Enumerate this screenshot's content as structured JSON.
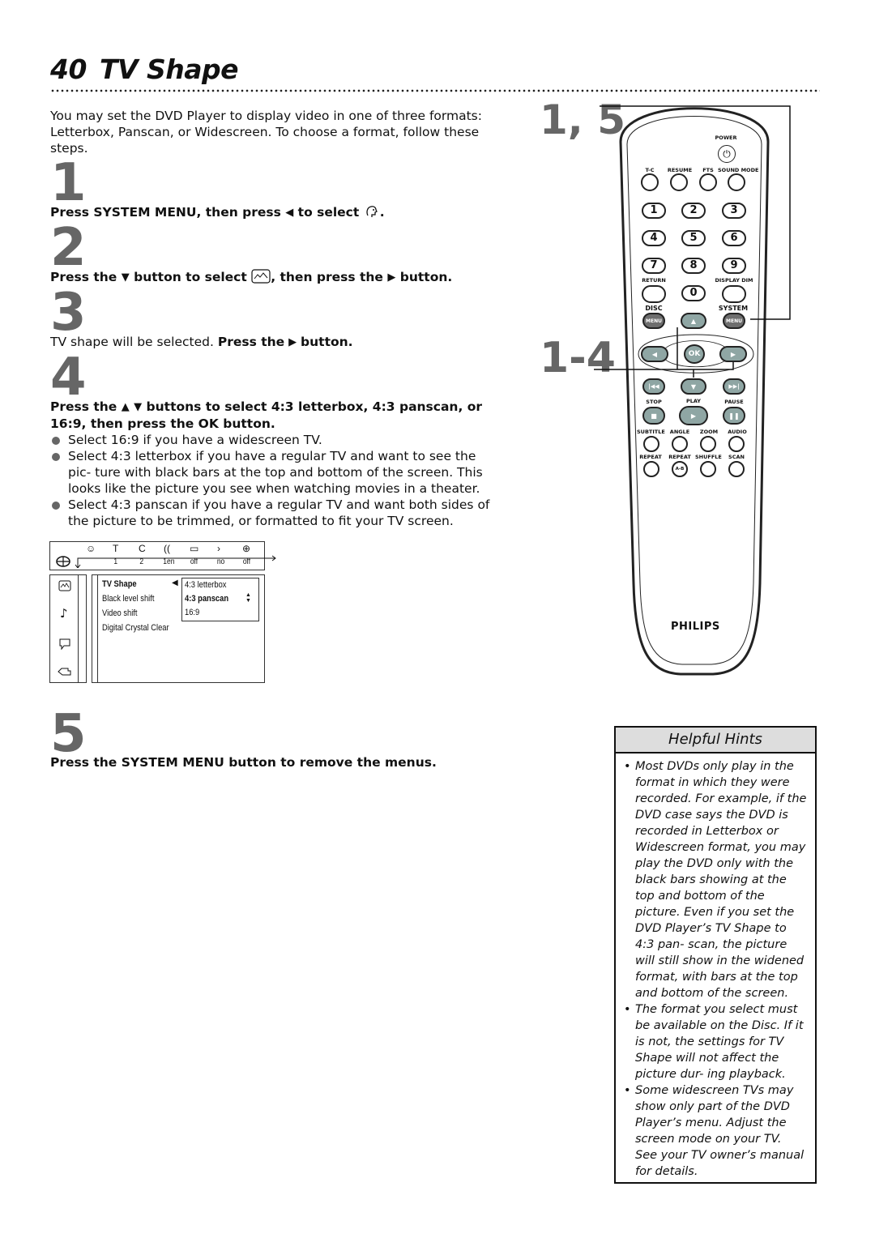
{
  "page": {
    "number": "40",
    "title": "TV Shape",
    "intro": "You may set the DVD Player to display video in one of three formats: Letterbox, Panscan, or Widescreen. To choose a format, follow these steps."
  },
  "steps": [
    {
      "num": "1",
      "parts": {
        "a": "Press SYSTEM MENU, then press",
        "b": "to select",
        "c": "."
      }
    },
    {
      "num": "2",
      "parts": {
        "a": "Press the",
        "b": "button to select",
        "c": ", then press the",
        "d": "button."
      }
    },
    {
      "num": "3",
      "parts": {
        "a": "TV shape will be selected.",
        "b": "Press the",
        "c": "button."
      }
    },
    {
      "num": "4",
      "parts": {
        "a": "Press the",
        "b": "buttons to select 4:3 letterbox, 4:3 panscan, or 16:9, then press the OK button."
      },
      "bullets": [
        "Select 16:9 if you have a widescreen TV.",
        "Select 4:3 letterbox if you have a regular TV and want to see the pic- ture with black bars at the top and bottom of the screen. This looks like the picture you see when watching movies in a theater.",
        "Select 4:3 panscan if you have a regular TV and want both sides of the picture to be trimmed, or formatted to fit your TV screen."
      ]
    },
    {
      "num": "5",
      "parts": {
        "a": "Press the SYSTEM MENU button to remove the menus."
      }
    }
  ],
  "osd": {
    "top_icons": [
      "settings-face-icon",
      "title-icon",
      "chapter-icon",
      "audio-lang-icon",
      "subtitle-icon",
      "angle-icon",
      "zoom-icon"
    ],
    "top_values": [
      "1",
      "2",
      "1en",
      "off",
      "no",
      "off"
    ],
    "menu_items": [
      "TV Shape",
      "Black level shift",
      "Video shift",
      "Digital Crystal Clear"
    ],
    "options": [
      "4:3 letterbox",
      "4:3 panscan",
      "16:9"
    ],
    "selected_option": "4:3 panscan"
  },
  "remote": {
    "callout_top": "1, 5",
    "callout_mid": "1-4",
    "labels": {
      "power": "POWER",
      "tc": "T-C",
      "resume": "RESUME",
      "fts": "FTS",
      "sound_mode": "SOUND MODE",
      "return": "RETURN",
      "display_dim": "DISPLAY DIM",
      "disc": "DISC",
      "system": "SYSTEM",
      "menu": "MENU",
      "ok": "OK",
      "stop": "STOP",
      "play": "PLAY",
      "pause": "PAUSE",
      "subtitle": "SUBTITLE",
      "angle": "ANGLE",
      "zoom": "ZOOM",
      "audio": "AUDIO",
      "repeat": "REPEAT",
      "repeat_ab": "REPEAT",
      "ab": "A-B",
      "shuffle": "SHUFFLE",
      "scan": "SCAN",
      "brand": "PHILIPS"
    },
    "digits": [
      "1",
      "2",
      "3",
      "4",
      "5",
      "6",
      "7",
      "8",
      "9",
      "0"
    ]
  },
  "hints": {
    "title": "Helpful Hints",
    "items": [
      "Most DVDs only play in the format in which they were recorded. For example, if the DVD case says the DVD is recorded in Letterbox or Widescreen format, you may play the DVD only with the black bars showing at the top and bottom of the picture. Even if you set the DVD Player’s TV Shape to 4:3 pan- scan, the picture will still show in the widened format, with bars at the top and bottom of the screen.",
      "The format you select must be available on the Disc. If it is not, the settings for TV Shape will not affect the picture dur- ing playback.",
      "Some widescreen TVs may show only part of the DVD Player’s menu. Adjust the screen mode on your TV. See your TV owner’s manual for details."
    ]
  }
}
